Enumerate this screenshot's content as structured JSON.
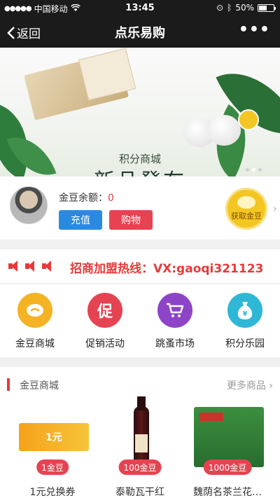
{
  "status_bar": {
    "carrier": "中国移动",
    "time": "13:45",
    "battery": "50%",
    "battery_level": 0.5
  },
  "nav": {
    "back_label": "返回",
    "title": "点乐易购",
    "more_label": "•••"
  },
  "banner": {
    "subtitle": "积分商城",
    "headline": "新品發布",
    "slides": 3,
    "active_slide": 1
  },
  "account": {
    "balance_label": "金豆余额：",
    "balance_value": "0",
    "recharge_label": "充值",
    "shop_label": "购物",
    "get_beans_label": "获取金豆"
  },
  "notice": {
    "text": "招商加盟热线：VX:gaoqi321123"
  },
  "categories": [
    {
      "name": "金豆商城",
      "icon": "gold-bean-icon",
      "color": "#f5b324",
      "glyph": "●"
    },
    {
      "name": "促销活动",
      "icon": "promotion-icon",
      "color": "#e64352",
      "glyph": "促"
    },
    {
      "name": "跳蚤市场",
      "icon": "cart-icon",
      "color": "#8e44c6",
      "glyph": "🛒"
    },
    {
      "name": "积分乐园",
      "icon": "money-bag-icon",
      "color": "#2fb7d6",
      "glyph": "¥"
    }
  ],
  "goods": {
    "title": "金豆商城",
    "more_label": "更多商品",
    "items": [
      {
        "name": "1元兑换券",
        "price": "1金豆",
        "coupon_text": "1元"
      },
      {
        "name": "泰勒瓦干红",
        "price": "100金豆"
      },
      {
        "name": "魏荫名茶兰花…",
        "price": "1000金豆"
      }
    ]
  },
  "colors": {
    "accent_red": "#e64352",
    "recharge_blue": "#2a8ae0",
    "gold": "#f3c623"
  }
}
